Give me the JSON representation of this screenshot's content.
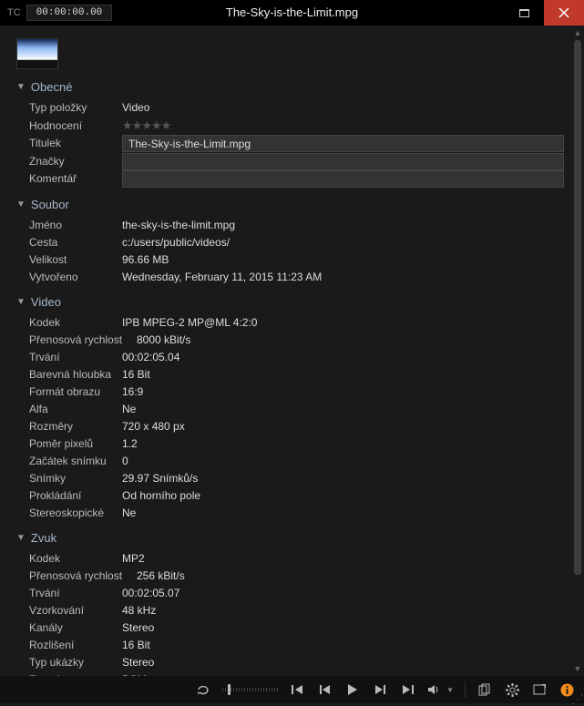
{
  "titlebar": {
    "tc_label": "TC",
    "timecode": "00:00:00.00",
    "title": "The-Sky-is-the-Limit.mpg"
  },
  "sections": {
    "general": {
      "title": "Obecné",
      "type_label": "Typ položky",
      "type_value": "Video",
      "rating_label": "Hodnocení",
      "title_label": "Titulek",
      "title_value": "The-Sky-is-the-Limit.mpg",
      "tags_label": "Značky",
      "tags_value": "",
      "comment_label": "Komentář",
      "comment_value": ""
    },
    "file": {
      "title": "Soubor",
      "name_label": "Jméno",
      "name_value": "the-sky-is-the-limit.mpg",
      "path_label": "Cesta",
      "path_value": "c:/users/public/videos/",
      "size_label": "Velikost",
      "size_value": "96.66 MB",
      "created_label": "Vytvořeno",
      "created_value": "Wednesday, February 11, 2015 11:23 AM"
    },
    "video": {
      "title": "Video",
      "codec_label": "Kodek",
      "codec_value": "IPB MPEG-2  MP@ML 4:2:0",
      "bitrate_label": "Přenosová rychlost",
      "bitrate_value": "8000 kBit/s",
      "duration_label": "Trvání",
      "duration_value": "00:02:05.04",
      "depth_label": "Barevná hloubka",
      "depth_value": "16 Bit",
      "aspect_label": "Formát obrazu",
      "aspect_value": "16:9",
      "alpha_label": "Alfa",
      "alpha_value": "Ne",
      "dims_label": "Rozměry",
      "dims_value": "720 x 480 px",
      "par_label": "Poměr pixelů",
      "par_value": "1.2",
      "start_label": "Začátek snímku",
      "start_value": "0",
      "fps_label": "Snímky",
      "fps_value": "29.97 Snímků/s",
      "interlace_label": "Prokládání",
      "interlace_value": "Od horního pole",
      "stereo_label": "Stereoskopické",
      "stereo_value": "Ne"
    },
    "audio": {
      "title": "Zvuk",
      "codec_label": "Kodek",
      "codec_value": "MP2",
      "bitrate_label": "Přenosová rychlost",
      "bitrate_value": "256 kBit/s",
      "duration_label": "Trvání",
      "duration_value": "00:02:05.07",
      "sample_label": "Vzorkování",
      "sample_value": "48 kHz",
      "channels_label": "Kanály",
      "channels_value": "Stereo",
      "res_label": "Rozlišení",
      "res_value": "16 Bit",
      "sampletype_label": "Typ ukázky",
      "sampletype_value": "Stereo",
      "format_label": "Formát",
      "format_value": "PCM"
    }
  }
}
